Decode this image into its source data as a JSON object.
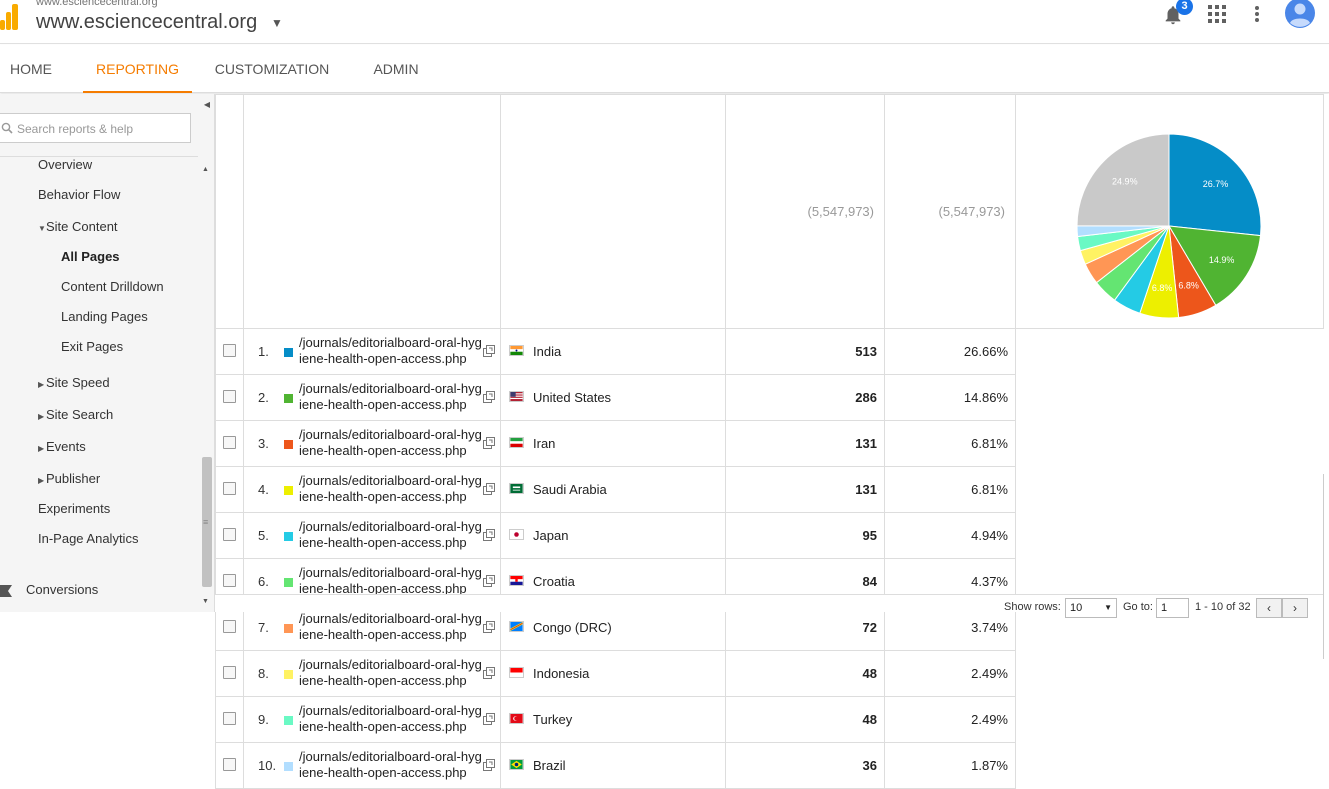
{
  "header": {
    "account_name": "www.esciencecentral.org",
    "property_name": "www.esciencecentral.org",
    "notification_count": "3"
  },
  "nav": {
    "tabs": [
      {
        "label": "HOME",
        "active": false
      },
      {
        "label": "REPORTING",
        "active": true
      },
      {
        "label": "CUSTOMIZATION",
        "active": false
      },
      {
        "label": "ADMIN",
        "active": false
      }
    ]
  },
  "sidebar": {
    "search_placeholder": "Search reports & help",
    "items": [
      {
        "label": "Overview"
      },
      {
        "label": "Behavior Flow"
      },
      {
        "label": "Site Content"
      },
      {
        "label": "All Pages"
      },
      {
        "label": "Content Drilldown"
      },
      {
        "label": "Landing Pages"
      },
      {
        "label": "Exit Pages"
      },
      {
        "label": "Site Speed"
      },
      {
        "label": "Site Search"
      },
      {
        "label": "Events"
      },
      {
        "label": "Publisher"
      },
      {
        "label": "Experiments"
      },
      {
        "label": "In-Page Analytics"
      },
      {
        "label": "Conversions"
      }
    ]
  },
  "table": {
    "header_totals": [
      "(5,547,973)",
      "(5,547,973)"
    ],
    "rows": [
      {
        "index": "1.",
        "color": "#058dc7",
        "page_line1": "/journals/editorialboard-oral-hyg",
        "page_line2": "iene-health-open-access.php",
        "country": "India",
        "value": "513",
        "percent": "26.66%"
      },
      {
        "index": "2.",
        "color": "#50b432",
        "page_line1": "/journals/editorialboard-oral-hyg",
        "page_line2": "iene-health-open-access.php",
        "country": "United States",
        "value": "286",
        "percent": "14.86%"
      },
      {
        "index": "3.",
        "color": "#ed561b",
        "page_line1": "/journals/editorialboard-oral-hyg",
        "page_line2": "iene-health-open-access.php",
        "country": "Iran",
        "value": "131",
        "percent": "6.81%"
      },
      {
        "index": "4.",
        "color": "#edef00",
        "page_line1": "/journals/editorialboard-oral-hyg",
        "page_line2": "iene-health-open-access.php",
        "country": "Saudi Arabia",
        "value": "131",
        "percent": "6.81%"
      },
      {
        "index": "5.",
        "color": "#24cbe5",
        "page_line1": "/journals/editorialboard-oral-hyg",
        "page_line2": "iene-health-open-access.php",
        "country": "Japan",
        "value": "95",
        "percent": "4.94%"
      },
      {
        "index": "6.",
        "color": "#64e572",
        "page_line1": "/journals/editorialboard-oral-hyg",
        "page_line2": "iene-health-open-access.php",
        "country": "Croatia",
        "value": "84",
        "percent": "4.37%"
      },
      {
        "index": "7.",
        "color": "#ff9655",
        "page_line1": "/journals/editorialboard-oral-hyg",
        "page_line2": "iene-health-open-access.php",
        "country": "Congo (DRC)",
        "value": "72",
        "percent": "3.74%"
      },
      {
        "index": "8.",
        "color": "#fff263",
        "page_line1": "/journals/editorialboard-oral-hyg",
        "page_line2": "iene-health-open-access.php",
        "country": "Indonesia",
        "value": "48",
        "percent": "2.49%"
      },
      {
        "index": "9.",
        "color": "#6af9c4",
        "page_line1": "/journals/editorialboard-oral-hyg",
        "page_line2": "iene-health-open-access.php",
        "country": "Turkey",
        "value": "48",
        "percent": "2.49%"
      },
      {
        "index": "10.",
        "color": "#b2deff",
        "page_line1": "/journals/editorialboard-oral-hyg",
        "page_line2": "iene-health-open-access.php",
        "country": "Brazil",
        "value": "36",
        "percent": "1.87%"
      }
    ]
  },
  "pie": {
    "slices": [
      {
        "value": 26.66,
        "color": "#058dc7",
        "label": "26.7%"
      },
      {
        "value": 14.86,
        "color": "#50b432",
        "label": "14.9%"
      },
      {
        "value": 6.81,
        "color": "#ed561b",
        "label": "6.8%"
      },
      {
        "value": 6.81,
        "color": "#edef00",
        "label": "6.8%"
      },
      {
        "value": 4.94,
        "color": "#24cbe5",
        "label": ""
      },
      {
        "value": 4.37,
        "color": "#64e572",
        "label": ""
      },
      {
        "value": 3.74,
        "color": "#ff9655",
        "label": ""
      },
      {
        "value": 2.49,
        "color": "#fff263",
        "label": ""
      },
      {
        "value": 2.49,
        "color": "#6af9c4",
        "label": ""
      },
      {
        "value": 1.87,
        "color": "#b2deff",
        "label": ""
      },
      {
        "value": 24.96,
        "color": "#c9c9c9",
        "label": "24.9%"
      }
    ]
  },
  "footer": {
    "show_rows_label": "Show rows:",
    "show_rows_value": "10",
    "goto_label": "Go to:",
    "goto_value": "1",
    "range_text": "1 - 10 of 32"
  }
}
